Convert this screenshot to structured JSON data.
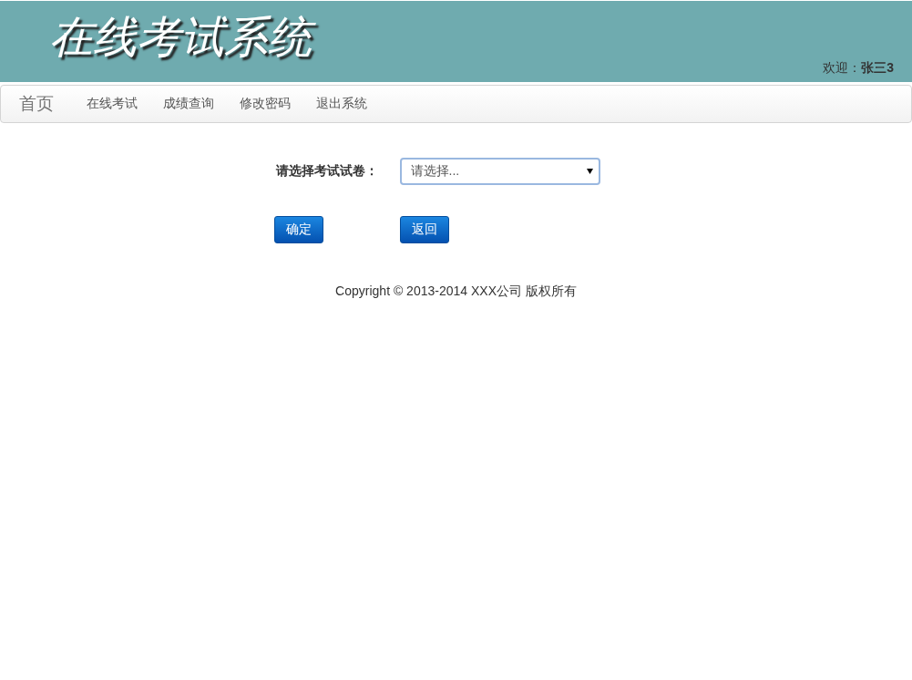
{
  "header": {
    "title": "在线考试系统",
    "welcome": "欢迎：**张三3**"
  },
  "nav": {
    "brand": "首页",
    "items": [
      "在线考试",
      "成绩查询",
      "修改密码",
      "退出系统"
    ]
  },
  "form": {
    "label": "请选择考试试卷：",
    "select": {
      "value": "请选择..."
    },
    "buttons": [
      "确定",
      "返回"
    ]
  },
  "footer": "Copyright © 2013-2014 XXX公司 版权所有"
}
